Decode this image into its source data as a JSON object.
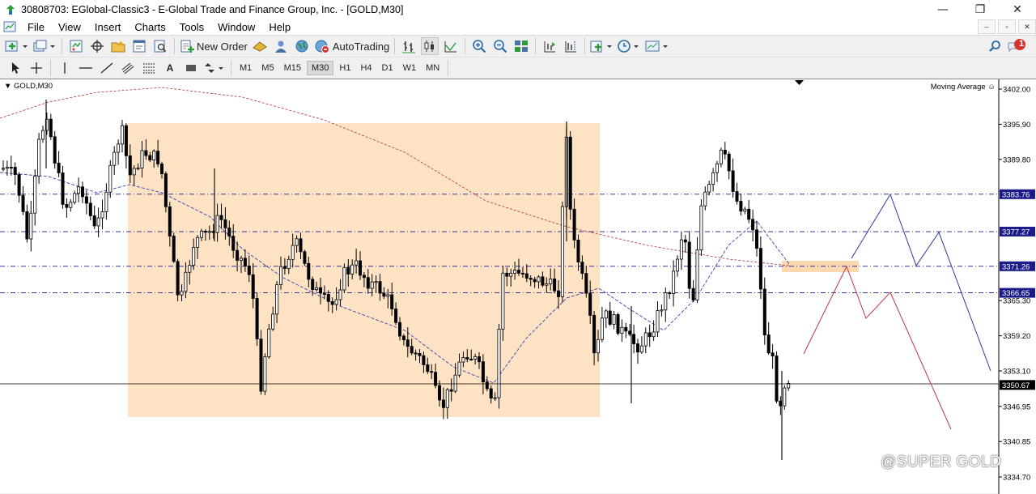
{
  "window": {
    "title": "30808703: EGlobal-Classic3 - E-Global Trade and Finance Group, Inc. - [GOLD,M30]",
    "minimize": "—",
    "restore": "❐",
    "close": "✕"
  },
  "menu": {
    "items": [
      "File",
      "View",
      "Insert",
      "Charts",
      "Tools",
      "Window",
      "Help"
    ],
    "mdi": [
      "–",
      "▫",
      "✕"
    ]
  },
  "toolbar": {
    "new_order": "New Order",
    "autotrading": "AutoTrading",
    "alerts_badge": "1",
    "text_tool": "A"
  },
  "timeframes": {
    "items": [
      "M1",
      "M5",
      "M15",
      "M30",
      "H1",
      "H4",
      "D1",
      "W1",
      "MN"
    ],
    "active": "M30"
  },
  "chart": {
    "symbol_label": "GOLD,M30",
    "indicator_label": "Moving Average",
    "watermark": "@SUPER GOLD",
    "price_ticks": [
      "3402.00",
      "3395.90",
      "3389.80",
      "3365.30",
      "3359.20",
      "3353.10",
      "3346.95",
      "3340.85",
      "3334.70"
    ],
    "level_labels": [
      "3383.76",
      "3377.27",
      "3371.26",
      "3366.65"
    ],
    "current_price": "3350.67",
    "colors": {
      "background": "#ffffff",
      "candle": "#000000",
      "rectangle": "#fde3c4",
      "level_line": "#1b1b8a",
      "ma_fast": "#3b3fae",
      "ma_slow": "#b03040",
      "projection_blue": "#2f3a9c",
      "projection_red": "#c0344a",
      "highlight_box": "#fbd8b0"
    }
  }
}
